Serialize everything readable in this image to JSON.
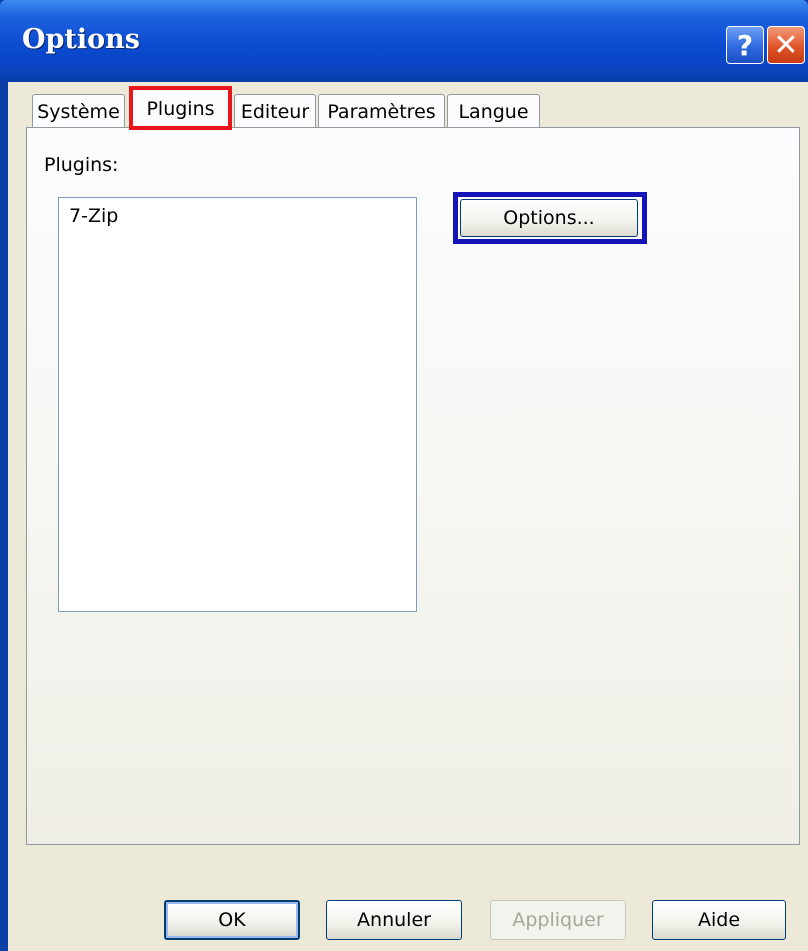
{
  "window": {
    "title": "Options",
    "help_glyph": "?",
    "close_glyph": "✕"
  },
  "tabs": [
    {
      "label": "Système",
      "active": false
    },
    {
      "label": "Plugins",
      "active": true
    },
    {
      "label": "Editeur",
      "active": false
    },
    {
      "label": "Paramètres",
      "active": false
    },
    {
      "label": "Langue",
      "active": false
    }
  ],
  "plugins_panel": {
    "label": "Plugins:",
    "list_items": [
      "7-Zip"
    ],
    "options_button": "Options..."
  },
  "footer": {
    "ok": "OK",
    "cancel": "Annuler",
    "apply": "Appliquer",
    "help": "Aide"
  },
  "colors": {
    "titlebar": "#0b4bd0",
    "active_tab_accent": "#e68b2c",
    "tab_highlight": "#e8151a",
    "button_highlight": "#1414b8"
  }
}
